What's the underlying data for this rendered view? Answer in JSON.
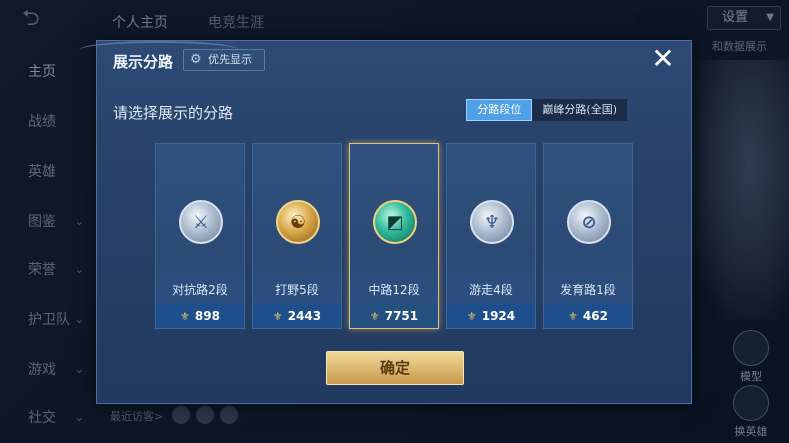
{
  "top_bar": {
    "tab_profile": "个人主页",
    "tab_career": "电竞生涯",
    "settings_label": "设置"
  },
  "sidebar": {
    "items": [
      {
        "label": "主页",
        "has_chevron": false
      },
      {
        "label": "战绩",
        "has_chevron": false
      },
      {
        "label": "英雄",
        "has_chevron": false
      },
      {
        "label": "图鉴",
        "has_chevron": true
      },
      {
        "label": "荣誉",
        "has_chevron": true
      },
      {
        "label": "护卫队",
        "has_chevron": true
      },
      {
        "label": "游戏",
        "has_chevron": true
      },
      {
        "label": "社交",
        "has_chevron": true
      }
    ]
  },
  "background": {
    "right_tag": "和数据展示",
    "recent_visitors": "最近访客>",
    "model_button": "模型",
    "swap_hero_button": "换英雄"
  },
  "dialog": {
    "title": "展示分路",
    "priority_button": "优先显示",
    "close_icon": "✕",
    "section_label": "请选择展示的分路",
    "tabs": [
      {
        "label": "分路段位",
        "active": true
      },
      {
        "label": "巅峰分路(全国)",
        "active": false
      }
    ],
    "cards": [
      {
        "name": "对抗路2段",
        "score": "898",
        "badge": "silver",
        "glyph": "⚔",
        "selected": false
      },
      {
        "name": "打野5段",
        "score": "2443",
        "badge": "gold",
        "glyph": "☯",
        "selected": false
      },
      {
        "name": "中路12段",
        "score": "7751",
        "badge": "emerald",
        "glyph": "◩",
        "selected": true
      },
      {
        "name": "游走4段",
        "score": "1924",
        "badge": "silver",
        "glyph": "♆",
        "selected": false
      },
      {
        "name": "发育路1段",
        "score": "462",
        "badge": "silver",
        "glyph": "⊘",
        "selected": false
      }
    ],
    "confirm_button": "确定"
  },
  "colors": {
    "accent_blue": "#4fa0e6",
    "confirm_gold": "#c89a4e",
    "selected_border": "#e3c07a"
  }
}
